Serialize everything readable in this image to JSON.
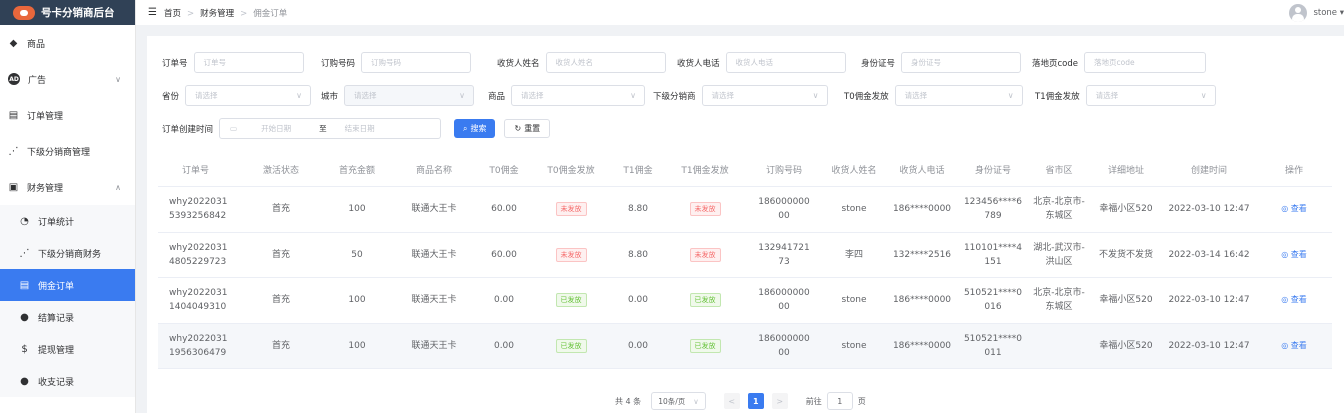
{
  "brand": {
    "title": "号卡分销商后台"
  },
  "header": {
    "collapse_icon": "☰",
    "breadcrumb": [
      "首页",
      "财务管理",
      "佣金订单"
    ],
    "user": "stone ▾"
  },
  "sidebar": {
    "items": [
      {
        "label": "商品",
        "icon": "goods-icon",
        "has_arrow": false
      },
      {
        "label": "广告",
        "icon": "ad-icon",
        "has_arrow": true,
        "arrow": "∨"
      },
      {
        "label": "订单管理",
        "icon": "order-icon",
        "has_arrow": false
      },
      {
        "label": "下级分销商管理",
        "icon": "distributor-icon",
        "has_arrow": false
      },
      {
        "label": "财务管理",
        "icon": "finance-icon",
        "has_arrow": true,
        "arrow": "∧"
      }
    ],
    "submenu": [
      {
        "label": "订单统计",
        "icon": "stats-icon",
        "active": false
      },
      {
        "label": "下级分销商财务",
        "icon": "sub-finance-icon",
        "active": false
      },
      {
        "label": "佣金订单",
        "icon": "commission-icon",
        "active": true
      },
      {
        "label": "结算记录",
        "icon": "settle-icon",
        "active": false
      },
      {
        "label": "提现管理",
        "icon": "withdraw-icon",
        "active": false
      },
      {
        "label": "收支记录",
        "icon": "ledger-icon",
        "active": false
      }
    ]
  },
  "filters": {
    "order_no": {
      "label": "订单号",
      "placeholder": "订单号"
    },
    "sub_code": {
      "label": "订购号码",
      "placeholder": "订购号码"
    },
    "name": {
      "label": "收货人姓名",
      "placeholder": "收货人姓名"
    },
    "phone": {
      "label": "收货人电话",
      "placeholder": "收货人电话"
    },
    "id_no": {
      "label": "身份证号",
      "placeholder": "身份证号"
    },
    "landing": {
      "label": "落地页code",
      "placeholder": "落地页code"
    },
    "province": {
      "label": "省份",
      "placeholder": "请选择"
    },
    "city": {
      "label": "城市",
      "placeholder": "请选择"
    },
    "goods": {
      "label": "商品",
      "placeholder": "请选择"
    },
    "sub_dist": {
      "label": "下级分销商",
      "placeholder": "请选择"
    },
    "t0": {
      "label": "T0佣金发放",
      "placeholder": "请选择"
    },
    "t1": {
      "label": "T1佣金发放",
      "placeholder": "请选择"
    },
    "created": {
      "label": "订单创建时间",
      "start": "开始日期",
      "to": "至",
      "end": "结束日期"
    },
    "search_label": "搜索",
    "reset_label": "重置"
  },
  "table": {
    "columns": [
      "订单号",
      "激活状态",
      "首充金额",
      "商品名称",
      "T0佣金",
      "T0佣金发放",
      "T1佣金",
      "T1佣金发放",
      "订购号码",
      "收货人姓名",
      "收货人电话",
      "身份证号",
      "省市区",
      "详细地址",
      "创建时间",
      "操作"
    ],
    "rows": [
      {
        "order_no": "why20220315393256842",
        "status": "首充",
        "amount": "100",
        "goods": "联通大王卡",
        "t0": "60.00",
        "t0_pay": "未发放",
        "t0_paid": false,
        "t1": "8.80",
        "t1_pay": "未发放",
        "t1_paid": false,
        "sub": "18600000000",
        "name": "stone",
        "phone": "186****0000",
        "id": "123456****6789",
        "region": "北京-北京市-东城区",
        "addr": "幸福小区520",
        "time": "2022-03-10 12:47",
        "op": "查看"
      },
      {
        "order_no": "why20220314805229723",
        "status": "首充",
        "amount": "50",
        "goods": "联通大王卡",
        "t0": "60.00",
        "t0_pay": "未发放",
        "t0_paid": false,
        "t1": "8.80",
        "t1_pay": "未发放",
        "t1_paid": false,
        "sub": "13294172173",
        "name": "李四",
        "phone": "132****2516",
        "id": "110101****4151",
        "region": "湖北-武汉市-洪山区",
        "addr": "不发货不发货",
        "time": "2022-03-14 16:42",
        "op": "查看"
      },
      {
        "order_no": "why20220311404049310",
        "status": "首充",
        "amount": "100",
        "goods": "联通天王卡",
        "t0": "0.00",
        "t0_pay": "已发放",
        "t0_paid": true,
        "t1": "0.00",
        "t1_pay": "已发放",
        "t1_paid": true,
        "sub": "18600000000",
        "name": "stone",
        "phone": "186****0000",
        "id": "510521****0016",
        "region": "北京-北京市-东城区",
        "addr": "幸福小区520",
        "time": "2022-03-10 12:47",
        "op": "查看"
      },
      {
        "order_no": "why20220311956306479",
        "status": "首充",
        "amount": "100",
        "goods": "联通天王卡",
        "t0": "0.00",
        "t0_pay": "已发放",
        "t0_paid": true,
        "t1": "0.00",
        "t1_pay": "已发放",
        "t1_paid": true,
        "sub": "18600000000",
        "name": "stone",
        "phone": "186****0000",
        "id": "510521****0011",
        "region": "",
        "addr": "幸福小区520",
        "time": "2022-03-10 12:47",
        "op": "查看"
      }
    ]
  },
  "pagination": {
    "total": "共 4 条",
    "page_size": "10条/页",
    "current": "1",
    "goto": "前往",
    "goto_value": "1",
    "page_unit": "页"
  }
}
